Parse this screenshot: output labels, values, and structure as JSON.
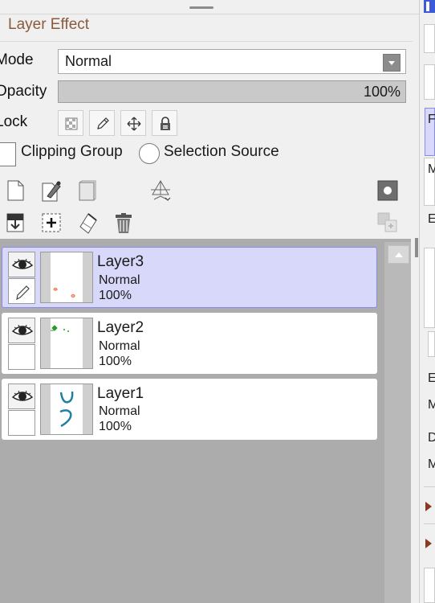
{
  "panel": {
    "title": "Layer Effect",
    "mode_label": "Mode",
    "mode_value": "Normal",
    "opacity_label": "Opacity",
    "opacity_value": "100%",
    "lock_label": "Lock",
    "clipping_group_label": "Clipping Group",
    "selection_source_label": "Selection Source"
  },
  "lock_buttons": [
    "lock-transparency-icon",
    "lock-draw-icon",
    "lock-move-icon",
    "lock-all-icon"
  ],
  "toolbar": {
    "row1": [
      "new-layer-icon",
      "new-vector-layer-icon",
      "new-folder-icon",
      "layer-property-icon",
      "layer-mask-icon"
    ],
    "row2": [
      "merge-down-icon",
      "new-layer-from-selection-icon",
      "clear-layer-icon",
      "delete-layer-icon",
      "apply-mask-icon"
    ]
  },
  "layers": [
    {
      "name": "Layer3",
      "mode": "Normal",
      "opacity": "100%",
      "selected": true
    },
    {
      "name": "Layer2",
      "mode": "Normal",
      "opacity": "100%",
      "selected": false
    },
    {
      "name": "Layer1",
      "mode": "Normal",
      "opacity": "100%",
      "selected": false
    }
  ],
  "right_panel": {
    "letters": [
      "F",
      "M",
      "E",
      "E",
      "M",
      "D",
      "M"
    ]
  },
  "colors": {
    "title": "#8a5a3b",
    "selected_layer_bg": "#d8d8fa",
    "selected_layer_border": "#8a8ae8",
    "list_bg": "#acacac"
  }
}
